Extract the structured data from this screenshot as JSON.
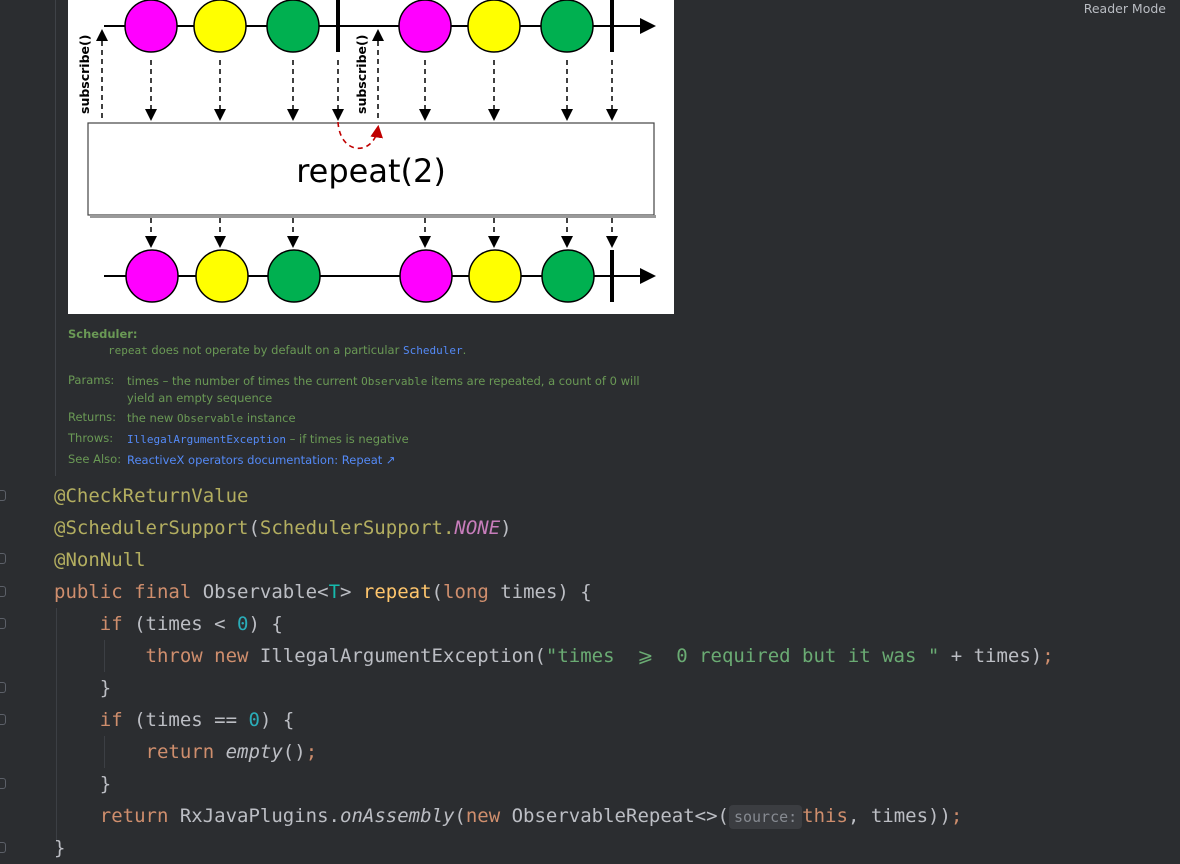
{
  "reader_mode": "Reader Mode",
  "diagram": {
    "operator_label": "repeat(2)",
    "subscribe_label": "subscribe()",
    "colors": {
      "magenta": "#ff00ff",
      "yellow": "#ffff00",
      "green": "#00b050",
      "dashed_red": "#c00000"
    }
  },
  "doc": {
    "scheduler_heading": "Scheduler:",
    "scheduler_code": "repeat",
    "scheduler_text": " does not operate by default on a particular ",
    "scheduler_link": "Scheduler",
    "scheduler_end": ".",
    "params_key": "Params:",
    "params_name": "times",
    "params_text_1": " – the number of times the current ",
    "params_code": "Observable",
    "params_text_2": " items are repeated, a count of 0 will yield an empty sequence",
    "returns_key": "Returns:",
    "returns_text_1": "the new ",
    "returns_code": "Observable",
    "returns_text_2": " instance",
    "throws_key": "Throws:",
    "throws_link": "IllegalArgumentException",
    "throws_text": " – if times is negative",
    "see_also_key": "See Also:",
    "see_also_link": "ReactiveX operators documentation: Repeat ↗"
  },
  "code": {
    "line1": "@CheckReturnValue",
    "line2_ann": "@SchedulerSupport",
    "line2_open": "(",
    "line2_cls": "SchedulerSupport.",
    "line2_const": "NONE",
    "line2_close": ")",
    "line3": "@NonNull",
    "line4_kw": "public final ",
    "line4_type": "Observable<",
    "line4_tparam": "T",
    "line4_type2": "> ",
    "line4_method": "repeat",
    "line4_open": "(",
    "line4_kw2": "long ",
    "line4_param": "times) {",
    "line5_kw": "if ",
    "line5_a": "(times < ",
    "line5_num": "0",
    "line5_b": ") {",
    "line6_kw": "throw new ",
    "line6_cls": "IllegalArgumentException(",
    "line6_str": "\"times  ⩾  0 required but it was \"",
    "line6_b": " + times)",
    "line6_semi": ";",
    "line7": "}",
    "line8_kw": "if ",
    "line8_a": "(times == ",
    "line8_num": "0",
    "line8_b": ") {",
    "line9_kw": "return ",
    "line9_fn": "empty",
    "line9_b": "()",
    "line9_semi": ";",
    "line10": "}",
    "line11_kw": "return ",
    "line11_cls": "RxJavaPlugins.",
    "line11_fn": "onAssembly",
    "line11_open": "(",
    "line11_kw2": "new ",
    "line11_cls2": "ObservableRepeat<>(",
    "line11_hint": "source:",
    "line11_this": "this",
    "line11_b": ", times))",
    "line11_semi": ";",
    "line12": "}"
  }
}
